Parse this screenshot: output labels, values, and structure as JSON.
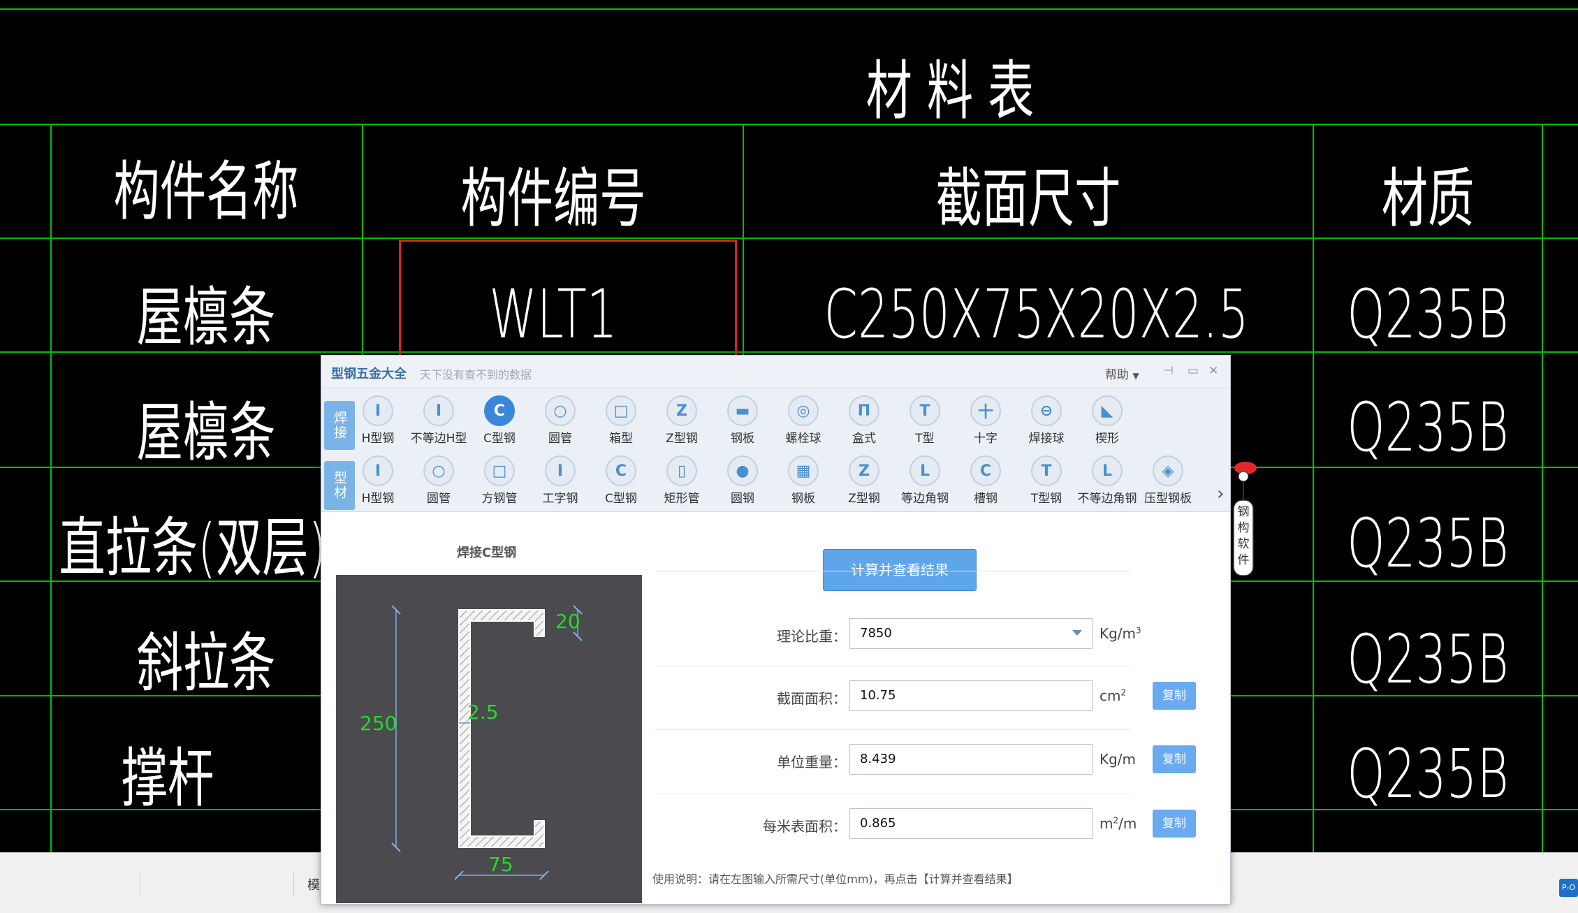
{
  "cad": {
    "table_title": "材 料 表",
    "headers": [
      "构件名称",
      "构件编号",
      "截面尺寸",
      "材质"
    ],
    "row1": {
      "name": "屋檩条",
      "code": "WLT1",
      "section": "C250X75X20X2.5",
      "material": "Q235B"
    },
    "names": [
      "屋檩条",
      "直拉条(双层)",
      "斜拉条",
      "撑杆"
    ],
    "materials": [
      "Q235B",
      "Q235B",
      "Q235B",
      "Q235B"
    ]
  },
  "tool": {
    "title": "型钢五金大全",
    "slogan": "天下没有查不到的数据",
    "help": "帮助",
    "welded_label": "焊接",
    "profile_label": "型材",
    "welded_items": [
      {
        "label": "H型钢",
        "icon": "h-beam-icon",
        "glyph": "I"
      },
      {
        "label": "不等边H型",
        "icon": "unequal-h-beam-icon",
        "glyph": "I"
      },
      {
        "label": "C型钢",
        "icon": "c-channel-icon",
        "glyph": "C"
      },
      {
        "label": "圆管",
        "icon": "round-tube-icon",
        "glyph": "○"
      },
      {
        "label": "箱型",
        "icon": "box-section-icon",
        "glyph": "□"
      },
      {
        "label": "Z型钢",
        "icon": "z-section-icon",
        "glyph": "Z"
      },
      {
        "label": "钢板",
        "icon": "steel-plate-icon",
        "glyph": "▬"
      },
      {
        "label": "螺栓球",
        "icon": "bolt-ball-icon",
        "glyph": "◎"
      },
      {
        "label": "盒式",
        "icon": "box-type-icon",
        "glyph": "Π"
      },
      {
        "label": "T型",
        "icon": "t-section-icon",
        "glyph": "T"
      },
      {
        "label": "十字",
        "icon": "cross-section-icon",
        "glyph": "十"
      },
      {
        "label": "焊接球",
        "icon": "welded-ball-icon",
        "glyph": "⊖"
      },
      {
        "label": "楔形",
        "icon": "wedge-icon",
        "glyph": "◣"
      }
    ],
    "profile_items": [
      {
        "label": "H型钢",
        "icon": "h-beam-icon",
        "glyph": "I"
      },
      {
        "label": "圆管",
        "icon": "round-tube-icon",
        "glyph": "○"
      },
      {
        "label": "方钢管",
        "icon": "square-tube-icon",
        "glyph": "□"
      },
      {
        "label": "工字钢",
        "icon": "i-beam-icon",
        "glyph": "I"
      },
      {
        "label": "C型钢",
        "icon": "c-channel-icon",
        "glyph": "C"
      },
      {
        "label": "矩形管",
        "icon": "rect-tube-icon",
        "glyph": "▯"
      },
      {
        "label": "圆钢",
        "icon": "round-bar-icon",
        "glyph": "●"
      },
      {
        "label": "钢板",
        "icon": "steel-plate-icon",
        "glyph": "▦"
      },
      {
        "label": "Z型钢",
        "icon": "z-section-icon",
        "glyph": "Z"
      },
      {
        "label": "等边角钢",
        "icon": "equal-angle-icon",
        "glyph": "L"
      },
      {
        "label": "槽钢",
        "icon": "channel-icon",
        "glyph": "C"
      },
      {
        "label": "T型钢",
        "icon": "t-section-icon",
        "glyph": "T"
      },
      {
        "label": "不等边角钢",
        "icon": "unequal-angle-icon",
        "glyph": "L"
      },
      {
        "label": "压型钢板",
        "icon": "profiled-sheet-icon",
        "glyph": "◈"
      }
    ],
    "preview_title": "焊接C型钢",
    "dims": {
      "height": "250",
      "width": "75",
      "lip": "20",
      "thickness": "2.5"
    },
    "calc_button": "计算并查看结果",
    "fields": {
      "density": {
        "label": "理论比重：",
        "value": "7850",
        "unit": "Kg/m",
        "unit_sup": "3"
      },
      "area": {
        "label": "截面面积：",
        "value": "10.75",
        "unit": "cm",
        "unit_sup": "2"
      },
      "weight": {
        "label": "单位重量：",
        "value": "8.439",
        "unit": "Kg/m"
      },
      "surface": {
        "label": "每米表面积：",
        "value": "0.865",
        "unit_pre": "m",
        "unit_sup": "2",
        "unit_post": "/m"
      }
    },
    "copy_label": "复制",
    "instruction": "使用说明：请在左图输入所需尺寸(单位mm)，再点击【计算并查看结果】",
    "mascot_text": "钢构软件"
  },
  "statusbar": {
    "text": "模",
    "right_button": "P-O"
  },
  "colors": {
    "grid": "#00c000",
    "highlight": "#e02020",
    "accent": "#3a86d8",
    "dim_text": "#22dd22"
  }
}
